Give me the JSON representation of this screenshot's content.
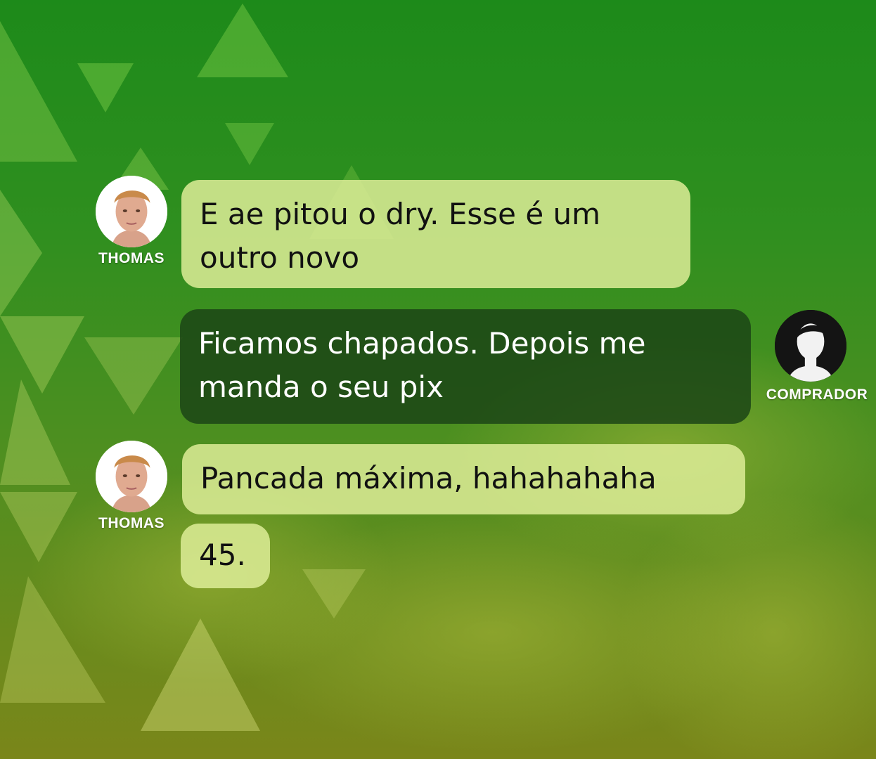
{
  "colors": {
    "accent_green": "#2a8a1c",
    "bubble_light": "#dcec96",
    "bubble_dark": "#1c4616"
  },
  "messages": [
    {
      "sender": "THOMAS",
      "text": "E ae pitou o dry. Esse é um\noutro novo"
    },
    {
      "sender": "COMPRADOR",
      "text": "Ficamos chapados. Depois me\nmanda o seu pix"
    },
    {
      "sender": "THOMAS",
      "text": "Pancada máxima, hahahahaha"
    },
    {
      "sender": "THOMAS",
      "text": "45."
    }
  ],
  "avatars": {
    "thomas_icon": "person-photo-icon",
    "comprador_icon": "anonymous-silhouette-icon"
  }
}
